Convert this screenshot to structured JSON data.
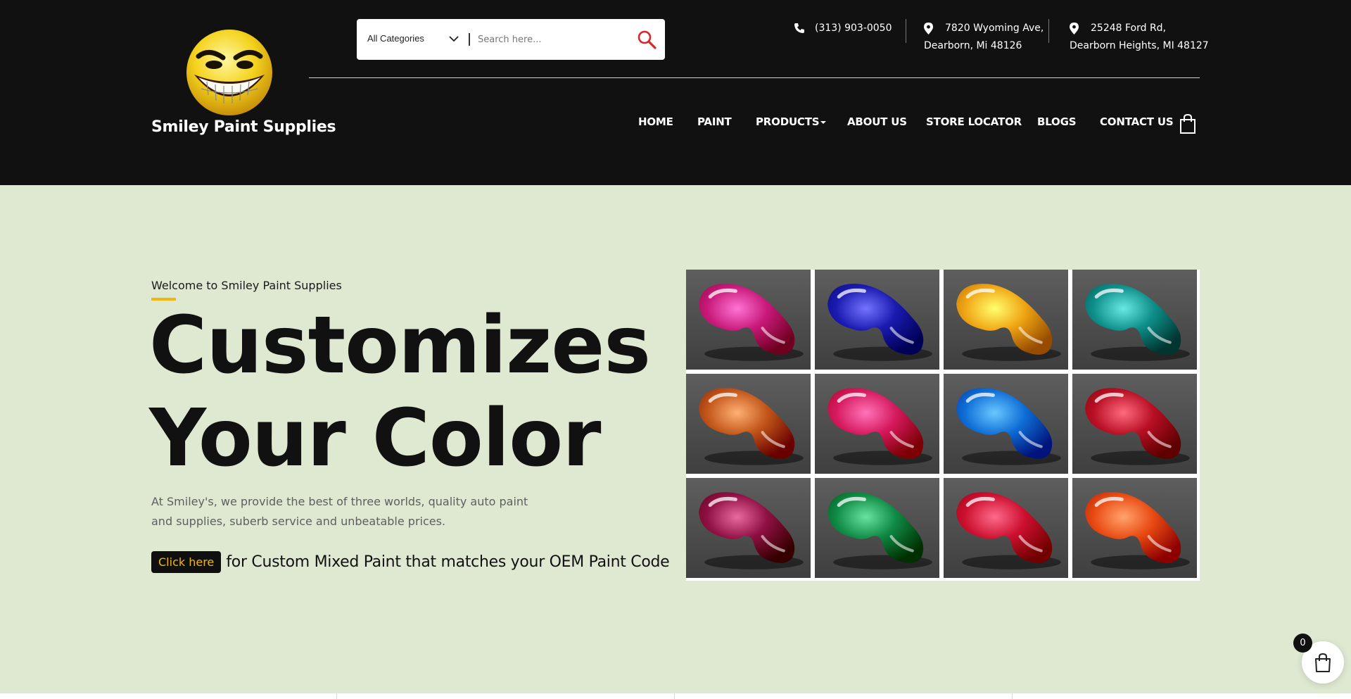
{
  "brand": {
    "name": "Smiley Paint Supplies",
    "logo_icon": "grinning-smiley-logo"
  },
  "search": {
    "category_selected": "All Categories",
    "placeholder": "Search here...",
    "value": ""
  },
  "contact": {
    "phone": "(313) 903-0050",
    "address1_line1": "7820 Wyoming Ave,",
    "address1_line2": "Dearborn, Mi 48126",
    "address2_line1": "25248 Ford Rd,",
    "address2_line2": "Dearborn Heights, MI 48127"
  },
  "nav": {
    "items": [
      {
        "label": "HOME"
      },
      {
        "label": "PAINT"
      },
      {
        "label": "PRODUCTS"
      },
      {
        "label": "ABOUT US"
      },
      {
        "label": "STORE LOCATOR"
      },
      {
        "label": "BLOGS"
      },
      {
        "label": "CONTACT US"
      }
    ]
  },
  "hero": {
    "welcome": "Welcome to Smiley Paint Supplies",
    "title_line1": "Customizes",
    "title_line2": "Your Color",
    "description": "At Smiley's, we provide the best of three worlds, quality auto paint and supplies, suberb service and unbeatable prices.",
    "cta_button": "Click here",
    "cta_text": "for Custom Mixed Paint that matches your OEM Paint Code"
  },
  "paint_swatches": [
    {
      "color": "magenta",
      "hex": "#c8197a"
    },
    {
      "color": "blue",
      "hex": "#1a1ab0"
    },
    {
      "color": "yellow",
      "hex": "#f0a514"
    },
    {
      "color": "teal",
      "hex": "#0e8f8a"
    },
    {
      "color": "orange",
      "hex": "#c2561a"
    },
    {
      "color": "pink",
      "hex": "#d6195e"
    },
    {
      "color": "sky-blue",
      "hex": "#0f6ed6"
    },
    {
      "color": "crimson",
      "hex": "#b80f24"
    },
    {
      "color": "wine",
      "hex": "#8f1043"
    },
    {
      "color": "green",
      "hex": "#0f8a45"
    },
    {
      "color": "red",
      "hex": "#cc1030"
    },
    {
      "color": "orange-red",
      "hex": "#e84a12"
    }
  ],
  "cart": {
    "count": "0"
  },
  "colors": {
    "header_bg": "#111111",
    "hero_bg": "#dfe9d2",
    "accent": "#f1b70d",
    "search_icon": "#d8262c"
  }
}
